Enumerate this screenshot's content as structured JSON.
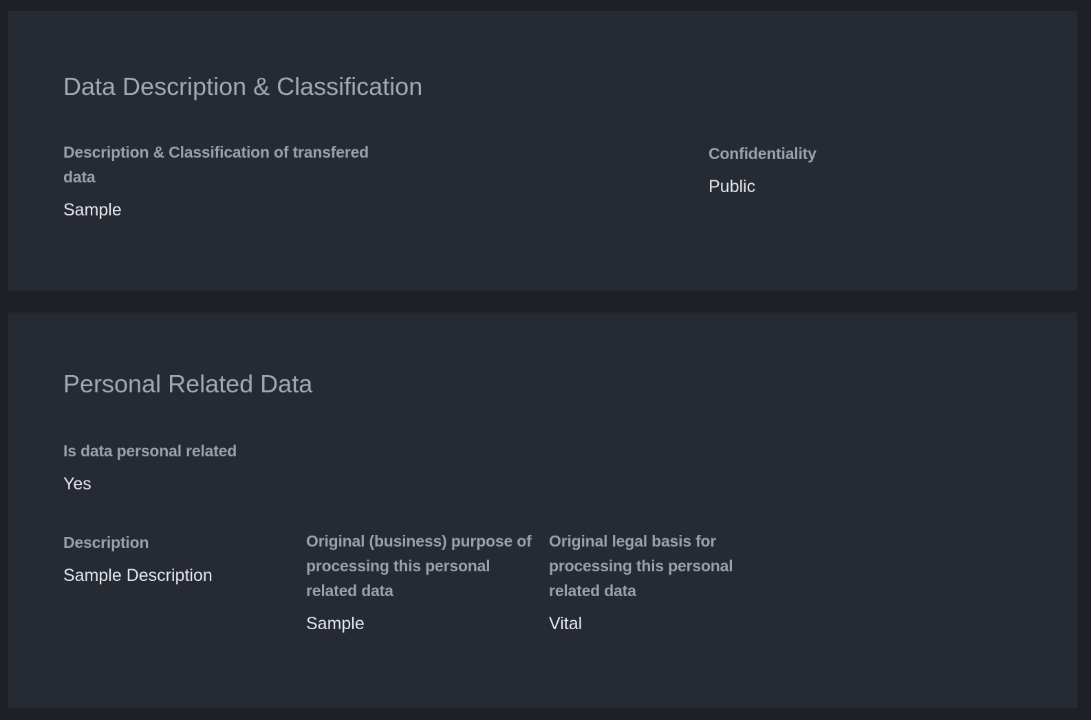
{
  "sections": {
    "classification": {
      "title": "Data Description & Classification",
      "fields": {
        "description": {
          "label": "Description & Classification of transfered data",
          "value": "Sample"
        },
        "confidentiality": {
          "label": "Confidentiality",
          "value": "Public"
        }
      }
    },
    "personal": {
      "title": "Personal Related Data",
      "fields": {
        "is_personal": {
          "label": "Is data personal related",
          "value": "Yes"
        },
        "description": {
          "label": "Description",
          "value": "Sample Description"
        },
        "purpose": {
          "label": "Original (business) purpose of processing this personal related data",
          "value": "Sample"
        },
        "legal_basis": {
          "label": "Original legal basis for processing this personal related data",
          "value": "Vital"
        }
      }
    }
  }
}
